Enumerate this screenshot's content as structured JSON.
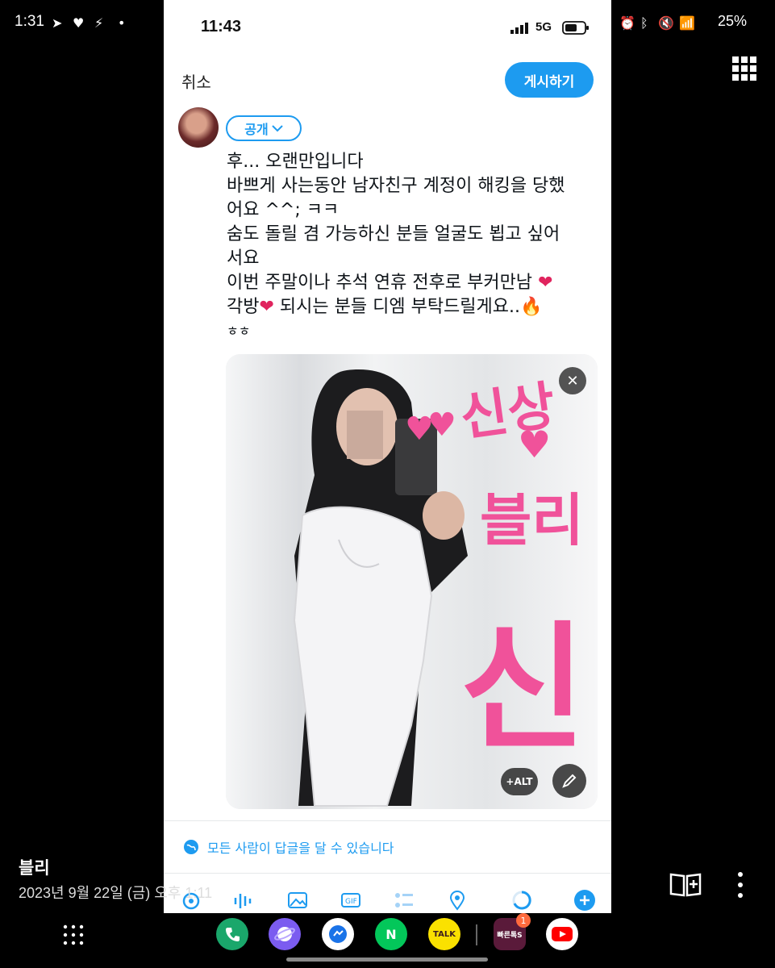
{
  "outer_status": {
    "time": "1:31",
    "battery": "25%"
  },
  "phone": {
    "status_time": "11:43",
    "network": "5G",
    "cancel_label": "취소",
    "post_label": "게시하기",
    "audience_label": "공개",
    "tweet_lines": [
      "후... 오랜만입니다",
      "바쁘게 사는동안 남자친구 계정이 해킹을 당했",
      "어요 ^^; ㅋㅋ",
      "숨도 돌릴 겸 가능하신 분들 얼굴도 뵙고 싶어",
      "서요",
      "이번 주말이나 추석 연휴 전후로 부커만남",
      "각방",
      "되시는 분들 디엠 부탁드릴게요..",
      "ㅎㅎ"
    ],
    "media": {
      "overlay_text_1": "신상",
      "overlay_text_2": "블리",
      "overlay_text_3": "신",
      "alt_label": "+ALT"
    },
    "reply_setting": "모든 사람이 답글을 달 수 있습니다"
  },
  "gallery": {
    "album_name": "블리",
    "date_text": "2023년 9월 22일 (금) 오후 1:11"
  },
  "dock": {
    "apps": [
      "phone",
      "internet",
      "messenger",
      "naver",
      "kakaotalk",
      "빠른톡S",
      "youtube"
    ],
    "badge_count": "1",
    "kakao_label": "TALK",
    "naver_label": "N",
    "bbaren_label": "빠른톡S"
  },
  "colors": {
    "accent": "#1d9bf0",
    "pink_overlay": "#f0529a",
    "heart": "#e0245e"
  }
}
